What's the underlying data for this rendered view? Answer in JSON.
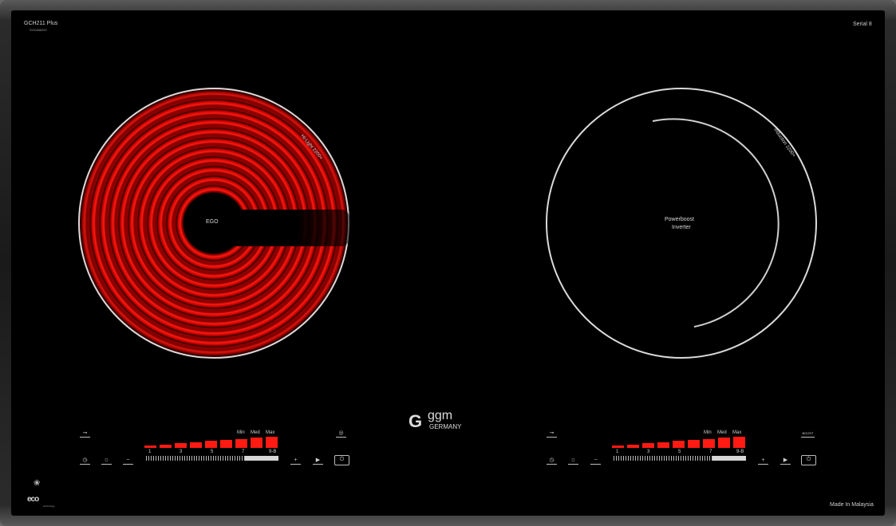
{
  "header": {
    "model": "GCH211 Plus",
    "model_code": "SCK888200",
    "serial": "Serial 8"
  },
  "zones": {
    "left": {
      "ring_label": "Hi-Light 2200+",
      "center_label": "EGO"
    },
    "right": {
      "ring_label": "Induction 2200+",
      "center_line1": "Powerboost",
      "center_line2": "Inverter"
    }
  },
  "controls": {
    "level_min": "Min",
    "level_med": "Med",
    "level_max": "Max",
    "scale": [
      "1",
      "3",
      "5",
      "7",
      "9-B"
    ],
    "power_levels": 9,
    "lock_icon": "key-lock-icon",
    "timer_icon": "clock-icon",
    "minus_label": "−",
    "plus_label": "+",
    "left_extra": "zone-ring-icon",
    "right_extra": "boost-icon"
  },
  "brand": {
    "logo_letter": "G",
    "name": "ggm",
    "country": "GERMANY"
  },
  "eco": {
    "label": "eco",
    "sub": "technology"
  },
  "footer": {
    "made_in": "Made In Malaysia"
  }
}
